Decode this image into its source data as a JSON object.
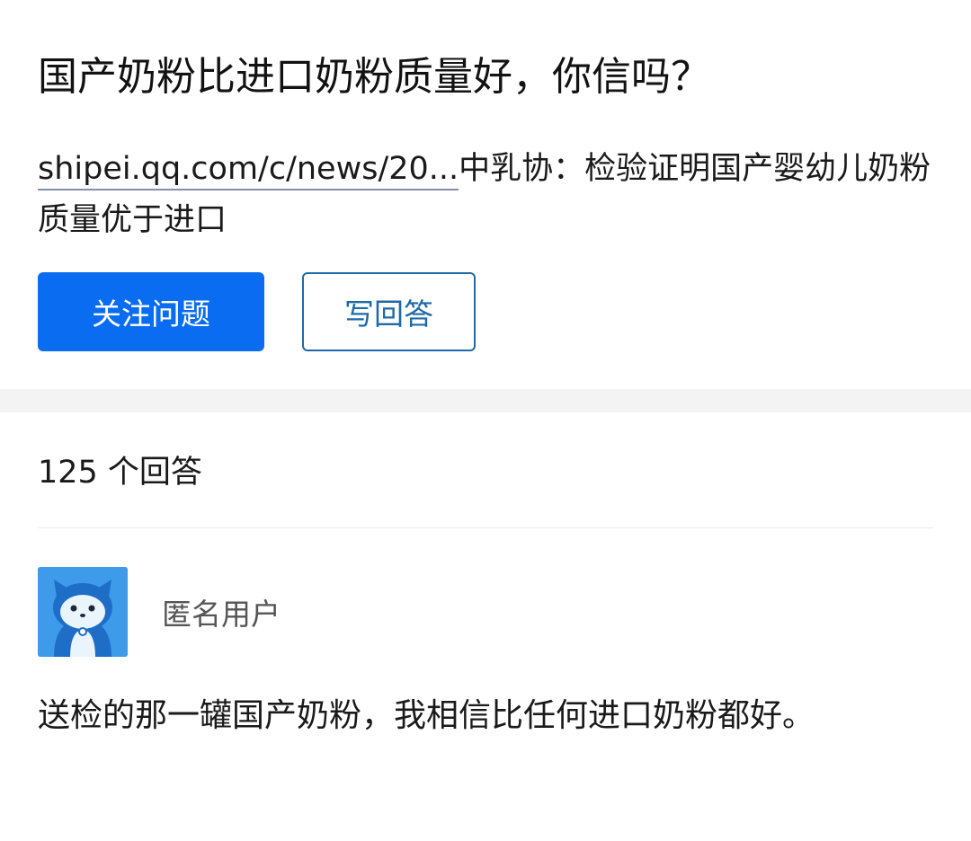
{
  "question": {
    "title": "国产奶粉比进口奶粉质量好，你信吗？",
    "link_text": "shipei.qq.com/c/news/20...",
    "detail_text": "中乳协：检验证明国产婴幼儿奶粉质量优于进口"
  },
  "actions": {
    "follow_label": "关注问题",
    "write_answer_label": "写回答"
  },
  "answers": {
    "count_label": "125 个回答",
    "items": [
      {
        "author": "匿名用户",
        "avatar_icon": "anonymous-user-avatar-icon",
        "content": "送检的那一罐国产奶粉，我相信比任何进口奶粉都好。"
      }
    ]
  },
  "colors": {
    "primary": "#0a6cf0",
    "outline_button": "#1e6aa8",
    "avatar_bg": "#3d9be9",
    "divider": "#f3f3f4"
  }
}
